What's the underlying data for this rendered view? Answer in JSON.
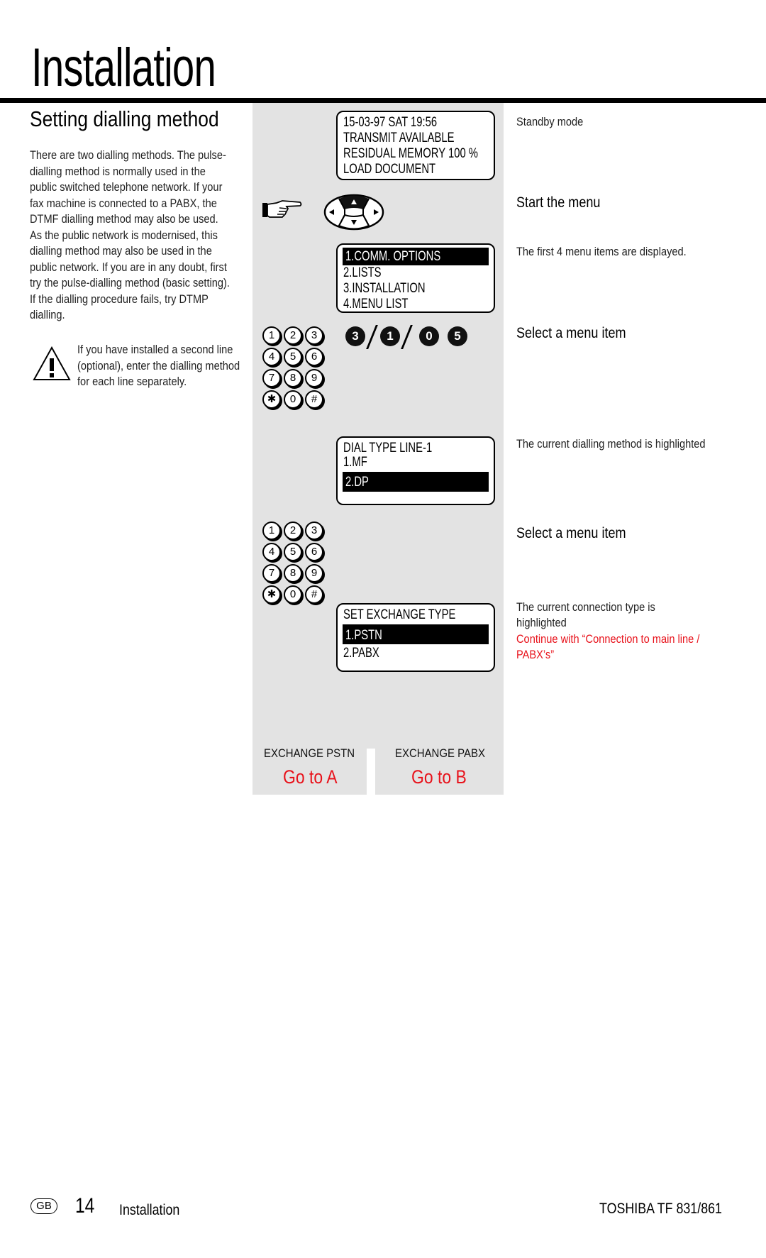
{
  "header": {
    "title": "Installation"
  },
  "section": {
    "title": "Setting dialling method",
    "intro": "There are two dialling methods. The pulse-dialling method is normally used in the public switched telephone network. If your fax machine is connected to a PABX, the DTMF dialling method may also be used. As the public network is modernised, this dialling method may also be used in the public network. If you are in any doubt, first try the pulse-dialling method (basic setting). If the dialling procedure fails, try DTMP dialling.",
    "warning": "If you have installed a second line (optional), enter the dialling method for each line separately."
  },
  "screens": {
    "standby": {
      "lines": [
        "15-03-97    SAT    19:56",
        "TRANSMIT AVAILABLE",
        "RESIDUAL MEMORY 100 %",
        "LOAD DOCUMENT"
      ]
    },
    "menu": {
      "highlighted": "1.COMM. OPTIONS",
      "lines": [
        "2.LISTS",
        "3.INSTALLATION",
        "4.MENU LIST"
      ]
    },
    "dial_type": {
      "header": "DIAL TYPE     LINE-1",
      "line1": "1.MF",
      "highlighted": "2.DP"
    },
    "exchange_type": {
      "header": "SET EXCHANGE TYPE",
      "highlighted": "1.PSTN",
      "line2": "2.PABX"
    }
  },
  "keypad": {
    "keys": [
      "1",
      "2",
      "3",
      "4",
      "5",
      "6",
      "7",
      "8",
      "9",
      "✱",
      "0",
      "#"
    ]
  },
  "key_sequence": [
    "3",
    "1",
    "0",
    "5"
  ],
  "steps": {
    "standby": "Standby mode",
    "start_menu": "Start the menu",
    "first_items": "The first 4 menu items are displayed.",
    "select_item_1": "Select a menu item",
    "current_method": "The current dialling method is highlighted",
    "select_item_2": "Select a menu item",
    "current_connection_1": "The current connection type is",
    "current_connection_2": "highlighted",
    "continue_1": "Continue with “Connection to main line /",
    "continue_2": "PABX’s”"
  },
  "exchange": {
    "pstn_label": "EXCHANGE  PSTN",
    "pstn_goto": "Go to A",
    "pabx_label": "EXCHANGE   PABX",
    "pabx_goto": "Go to B"
  },
  "footer": {
    "badge": "GB",
    "page": "14",
    "section": "Installation",
    "model": "TOSHIBA  TF 831/861"
  },
  "colors": {
    "accent_red": "#e8121b",
    "panel_gray": "#e3e3e3"
  }
}
